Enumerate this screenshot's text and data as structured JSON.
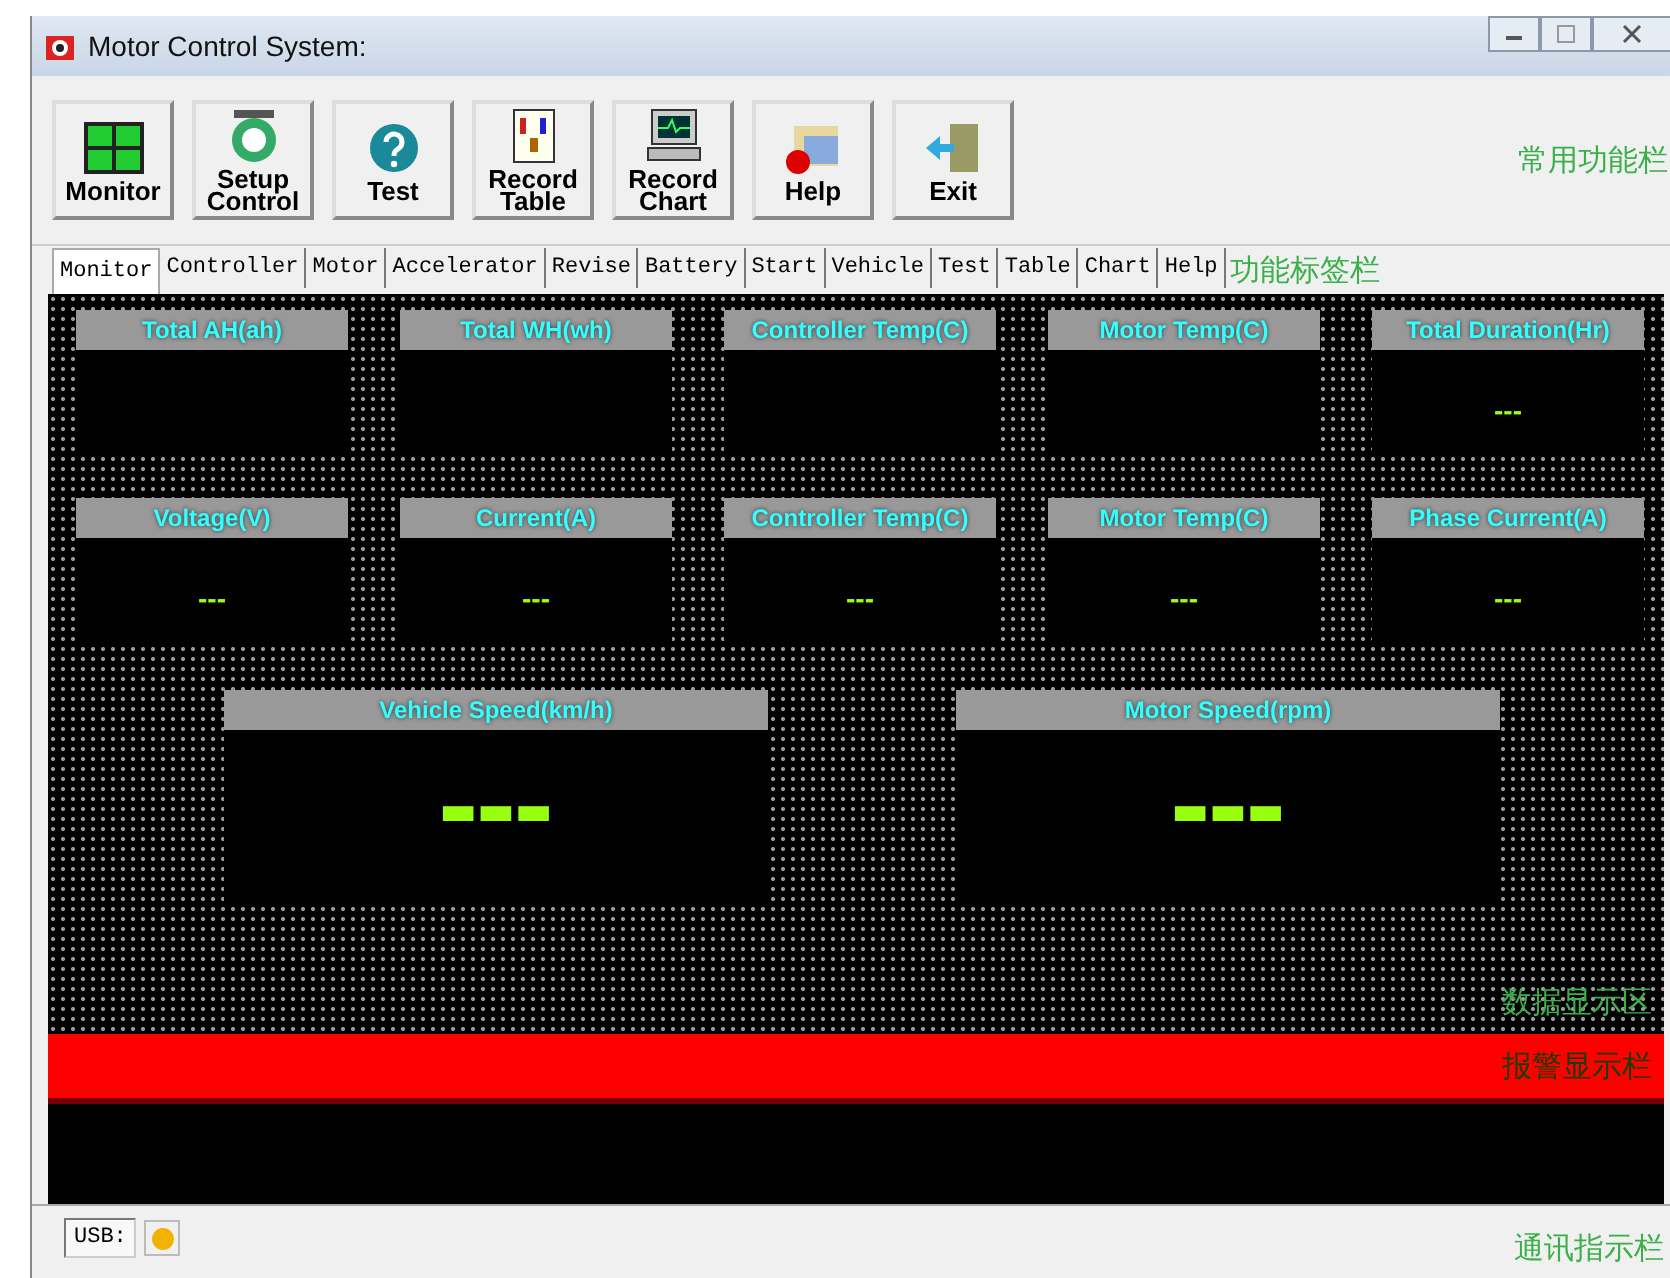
{
  "window": {
    "title": "Motor Control System:"
  },
  "toolbar": [
    {
      "label": "Monitor"
    },
    {
      "label": "Setup\nControl"
    },
    {
      "label": "Test"
    },
    {
      "label": "Record\nTable"
    },
    {
      "label": "Record\nChart"
    },
    {
      "label": "Help"
    },
    {
      "label": "Exit"
    }
  ],
  "toolbar_note": "常用功能栏",
  "tabs": [
    {
      "label": "Monitor",
      "selected": true
    },
    {
      "label": "Controller",
      "selected": false
    },
    {
      "label": "Motor",
      "selected": false
    },
    {
      "label": "Accelerator",
      "selected": false
    },
    {
      "label": "Revise",
      "selected": false
    },
    {
      "label": "Battery",
      "selected": false
    },
    {
      "label": "Start",
      "selected": false
    },
    {
      "label": "Vehicle",
      "selected": false
    },
    {
      "label": "Test",
      "selected": false
    },
    {
      "label": "Table",
      "selected": false
    },
    {
      "label": "Chart",
      "selected": false
    },
    {
      "label": "Help",
      "selected": false
    }
  ],
  "tabs_note": "功能标签栏",
  "panels_row_1": [
    {
      "title": "Total AH(ah)"
    },
    {
      "title": "Total WH(wh)"
    },
    {
      "title": "Controller Temp(C)"
    },
    {
      "title": "Motor Temp(C)"
    },
    {
      "title": "Total Duration(Hr)",
      "reading": "---"
    }
  ],
  "panels_row_2": [
    {
      "title": "Voltage(V)",
      "reading": "---"
    },
    {
      "title": "Current(A)",
      "reading": "---"
    },
    {
      "title": "Controller Temp(C)",
      "reading": "---"
    },
    {
      "title": "Motor Temp(C)",
      "reading": "---"
    },
    {
      "title": "Phase Current(A)",
      "reading": "---"
    }
  ],
  "speed_panels": [
    {
      "title": "Vehicle Speed(km/h)",
      "reading": "▬▬▬"
    },
    {
      "title": "Motor Speed(rpm)",
      "reading": "▬▬▬"
    }
  ],
  "data_note": "数据显示区",
  "alarm_note": "报警显示栏",
  "status_bar": {
    "indicators": [
      {
        "label": "USB:",
        "color": "#f0b400"
      }
    ],
    "note": "通讯指示栏"
  }
}
